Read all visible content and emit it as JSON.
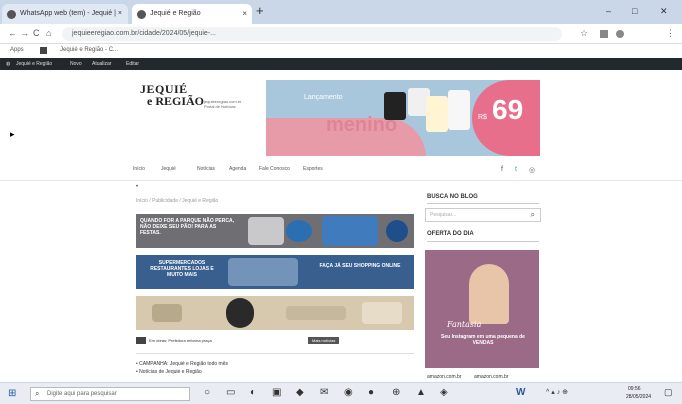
{
  "browser": {
    "tabs": [
      {
        "label": "WhatsApp web (tem) - Jequié | ×"
      },
      {
        "label": "Jequié e Região"
      }
    ],
    "new_tab": "+",
    "window_controls": [
      "–",
      "□",
      "✕"
    ],
    "url": "jequieeregiao.com.br/cidade/2024/05/jequie-...",
    "nav": [
      "←",
      "→",
      "C",
      "⌂"
    ],
    "toolbar_icons": [
      "☆",
      "⋮"
    ],
    "bookmarks": [
      "Apps",
      "Jequié e Região - C..."
    ],
    "admin_bar": [
      "Jequié e Região",
      "Novo",
      "Atualizar",
      "Editar"
    ]
  },
  "site": {
    "logo_line1": "JEQUIÉ",
    "logo_line2": "e REGIÃO",
    "logo_small1": "jequieeregiao.com.br",
    "logo_small2": "Portal de Notícias",
    "ad_brand": "menino",
    "ad_label": "Lançamento",
    "ad_price": "69",
    "ad_price_prefix": "R$",
    "menu": [
      "Início",
      "Jequié",
      "Notícias",
      "Agenda",
      "Fale Conosco",
      "Esportes"
    ],
    "social": [
      "f",
      "t",
      "◎"
    ],
    "marker": "•",
    "breadcrumb": "Início / Publicidade / Jequié e Região",
    "banner1": "QUANDO FOR A PARQUE NÃO PERCA, NÃO DEIXE SEU PÃO! PARA AS FESTAS.",
    "banner2a": "SUPERMERCADOS RESTAURANTES LOJAS E MUITO MAIS",
    "banner2b": "FAÇA JÁ SEU SHOPPING ONLINE",
    "banner3": "",
    "news_link": "Em obras: Prefeitura reforma praça",
    "news_tag": "Mais notícias",
    "item1": "• CAMPANHA: Jequié e Região todo mês",
    "item2": "• Notícias de Jequié e Região",
    "sidebar_title1": "BUSCA NO BLOG",
    "search_placeholder": "Pesquisar...",
    "search_icon": "⌕",
    "sidebar_title2": "OFERTA DO DIA",
    "sidebar_script": "Fantasia",
    "sidebar_caption": "Seu Instagram em uma pequena de VENDAS",
    "amazon1": "amazon.com.br",
    "amazon2": "amazon.com.br"
  },
  "taskbar": {
    "start": "⊞",
    "search_icon": "⌕",
    "search_placeholder": "Digite aqui para pesquisar",
    "apps": [
      "○",
      "▭",
      "◐",
      "▣",
      "◆",
      "✉",
      "◉",
      "●",
      "⊕",
      "▲",
      "◈",
      "W"
    ],
    "tray": "^ ▴ ♪ ⊕",
    "time": "09:56",
    "date": "28/05/2024"
  },
  "colors": {
    "chrome_tabbar": "#c9d7e8",
    "site_admin_bar": "#23282d",
    "ad_pink": "#e86f8b",
    "ad_blue": "#a8c7dd",
    "banner2": "#385f8e"
  }
}
